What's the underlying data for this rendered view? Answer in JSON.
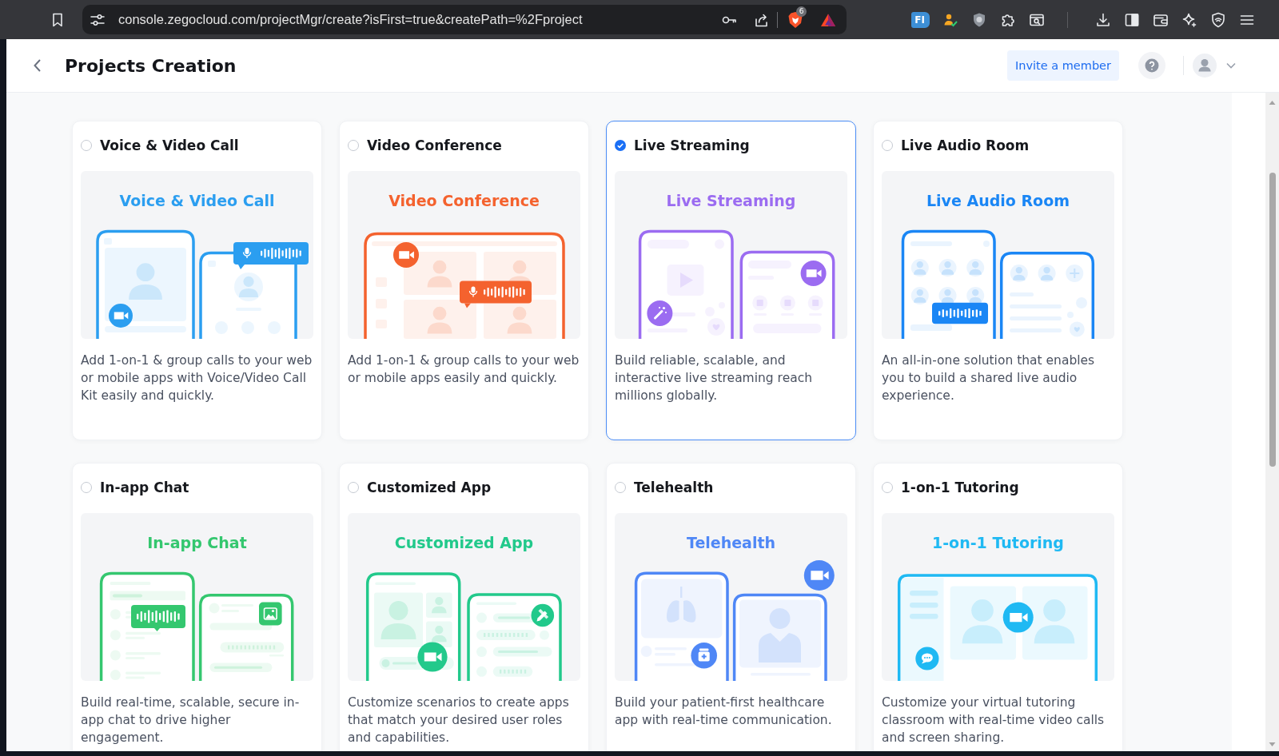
{
  "browser": {
    "url": "console.zegocloud.com/projectMgr/create?isFirst=true&createPath=%2Fproject",
    "shields_badge": "6",
    "extension_label": "FI"
  },
  "header": {
    "title": "Projects Creation",
    "invite_button": "Invite a member"
  },
  "cards": [
    {
      "title": "Voice & Video Call",
      "illustration_title": "Voice & Video Call",
      "description": "Add 1-on-1 & group calls to your web or mobile apps with Voice/Video Call Kit easily and quickly.",
      "selected": false,
      "kind": "call",
      "color": "#2b9ef0"
    },
    {
      "title": "Video Conference",
      "illustration_title": "Video Conference",
      "description": "Add 1-on-1 & group calls to your web or mobile apps easily and quickly.",
      "selected": false,
      "kind": "conference",
      "color": "#f4622e"
    },
    {
      "title": "Live Streaming",
      "illustration_title": "Live Streaming",
      "description": "Build reliable, scalable, and interactive live streaming reach millions globally.",
      "selected": true,
      "kind": "streaming",
      "color": "#9b6cf1"
    },
    {
      "title": "Live Audio Room",
      "illustration_title": "Live Audio Room",
      "description": "An all-in-one solution that enables you to build a shared live audio experience.",
      "selected": false,
      "kind": "audioroom",
      "color": "#1a86f5"
    },
    {
      "title": "In-app Chat",
      "illustration_title": "In-app Chat",
      "description": "Build real-time, scalable, secure in-app chat to drive higher engagement.",
      "selected": false,
      "kind": "chat",
      "color": "#34c76f"
    },
    {
      "title": "Customized App",
      "illustration_title": "Customized App",
      "description": "Customize scenarios to create apps that match your desired user roles and capabilities.",
      "selected": false,
      "kind": "custom",
      "color": "#22c98b"
    },
    {
      "title": "Telehealth",
      "illustration_title": "Telehealth",
      "description": "Build your patient-first healthcare app with real-time communication.",
      "selected": false,
      "kind": "telehealth",
      "color": "#4f87f6"
    },
    {
      "title": "1-on-1 Tutoring",
      "illustration_title": "1-on-1 Tutoring",
      "description": "Customize your virtual tutoring classroom with real-time video calls and screen sharing.",
      "selected": false,
      "kind": "tutoring",
      "color": "#1fb9f3"
    }
  ]
}
